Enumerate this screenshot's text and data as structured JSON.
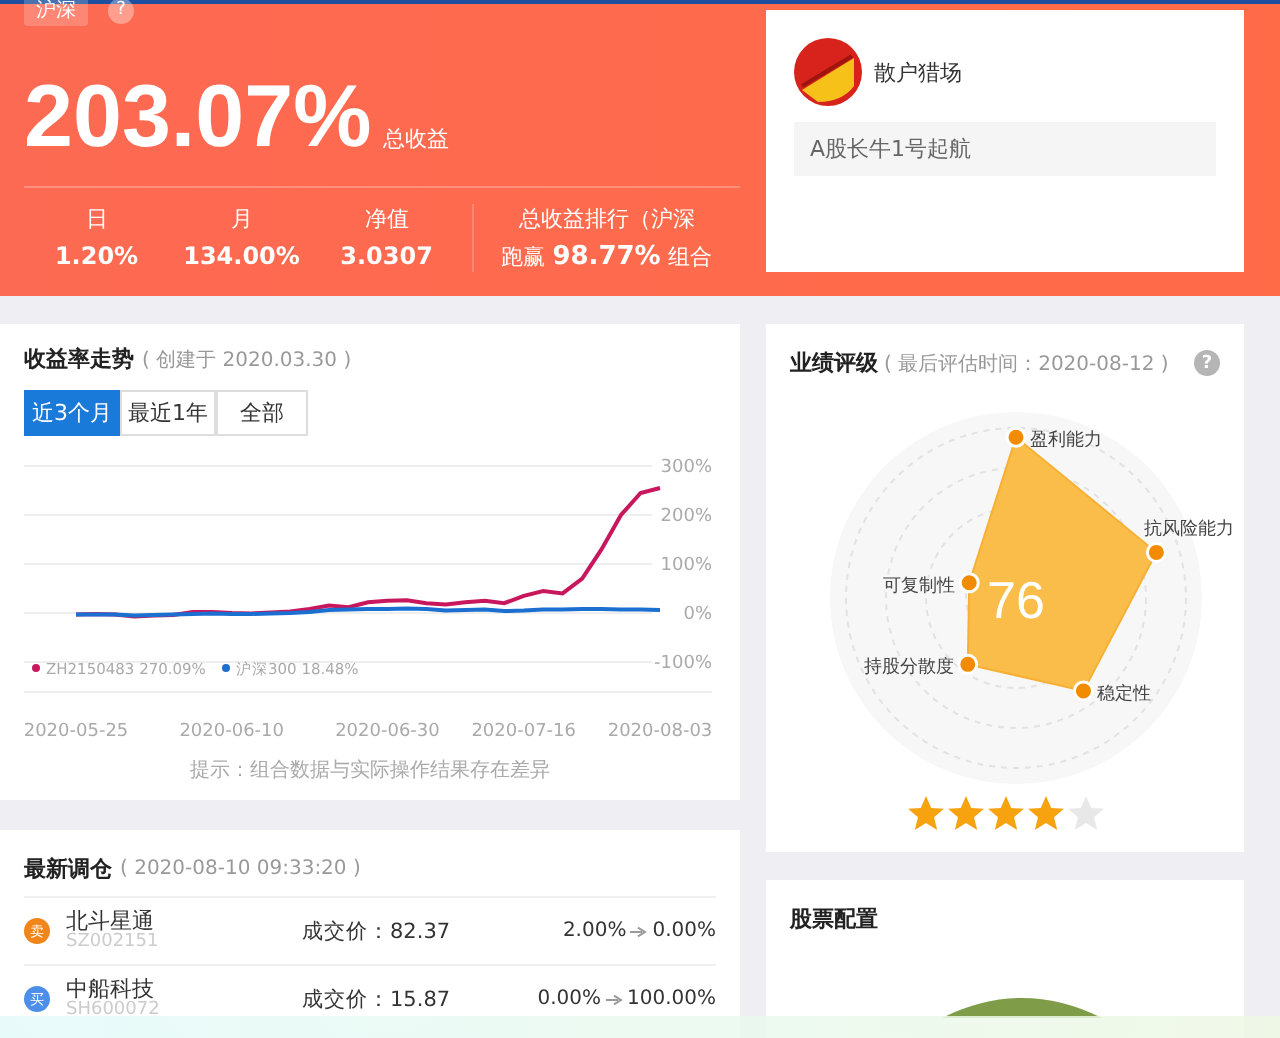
{
  "header": {
    "market_badge": "沪深",
    "help_icon": "?",
    "total_return": "203.07%",
    "total_return_label": "总收益",
    "stats": [
      {
        "label": "日",
        "value": "1.20%"
      },
      {
        "label": "月",
        "value": "134.00%"
      },
      {
        "label": "净值",
        "value": "3.0307"
      }
    ],
    "rank_label": "总收益排行（沪深",
    "rank_value": "跑赢 **98.77%** 组合"
  },
  "profile": {
    "name": "散户猎场",
    "motto": "A股长牛1号起航"
  },
  "trend": {
    "title": "收益率走势",
    "created": "( 创建于 2020.03.30 )",
    "tabs": [
      {
        "label": "近3个月",
        "selected": true
      },
      {
        "label": "最近1年",
        "selected": false
      },
      {
        "label": "全部",
        "selected": false
      }
    ],
    "chart_data": {
      "type": "line",
      "grid": true,
      "legend": "bottom",
      "categories": [
        "2020-05-25",
        null,
        null,
        null,
        null,
        null,
        null,
        null,
        "2020-06-10",
        null,
        null,
        null,
        null,
        null,
        null,
        null,
        "2020-06-30",
        null,
        null,
        null,
        null,
        null,
        null,
        "2020-07-16",
        null,
        null,
        null,
        null,
        null,
        null,
        "2020-08-03"
      ],
      "ylim": [
        -100,
        300
      ],
      "yticks": [
        {
          "value": 300,
          "label": "300%"
        },
        {
          "value": 200,
          "label": "200%"
        },
        {
          "value": 100,
          "label": "100%"
        },
        {
          "value": 0,
          "label": "0%"
        },
        {
          "value": -100,
          "label": "-100%"
        }
      ],
      "series": [
        {
          "name": "ZH2150483 270.09%",
          "color": "#c8175d",
          "values": [
            -3,
            -2,
            -3,
            -7,
            -5,
            -4,
            2,
            2,
            0,
            -1,
            1,
            3,
            8,
            15,
            12,
            22,
            25,
            26,
            20,
            17,
            22,
            25,
            20,
            35,
            45,
            40,
            70,
            130,
            200,
            245,
            255
          ]
        },
        {
          "name": "沪深300 18.48%",
          "color": "#1a6fd1",
          "values": [
            -3,
            -3,
            -3,
            -5,
            -4,
            -3,
            -2,
            -1,
            -2,
            -2,
            -1,
            0,
            2,
            6,
            7,
            8,
            8,
            9,
            8,
            5,
            6,
            7,
            4,
            5,
            7,
            7,
            8,
            8,
            7,
            7,
            6
          ]
        }
      ]
    },
    "hint": "提示：组合数据与实际操作结果存在差异"
  },
  "rating": {
    "title": "业绩评级",
    "time": "( 最后评估时间：2020-08-12 )",
    "help_icon": "?",
    "score": "76",
    "axes": [
      "盈利能力",
      "抗风险能力",
      "稳定性",
      "持股分散度",
      "可复制性"
    ],
    "stars": 4
  },
  "rebalance": {
    "title": "最新调仓",
    "time": "( 2020-08-10 09:33:20 )",
    "rows": [
      {
        "kind": "sell",
        "tag": "卖",
        "name": "北斗星通",
        "code": "SZ002151",
        "price": "成交价：82.37",
        "from": "2.00%",
        "to": "0.00%"
      },
      {
        "kind": "buy",
        "tag": "买",
        "name": "中船科技",
        "code": "SH600072",
        "price": "成交价：15.87",
        "from": "0.00%",
        "to": "100.00%"
      }
    ]
  },
  "allocation": {
    "title": "股票配置"
  }
}
